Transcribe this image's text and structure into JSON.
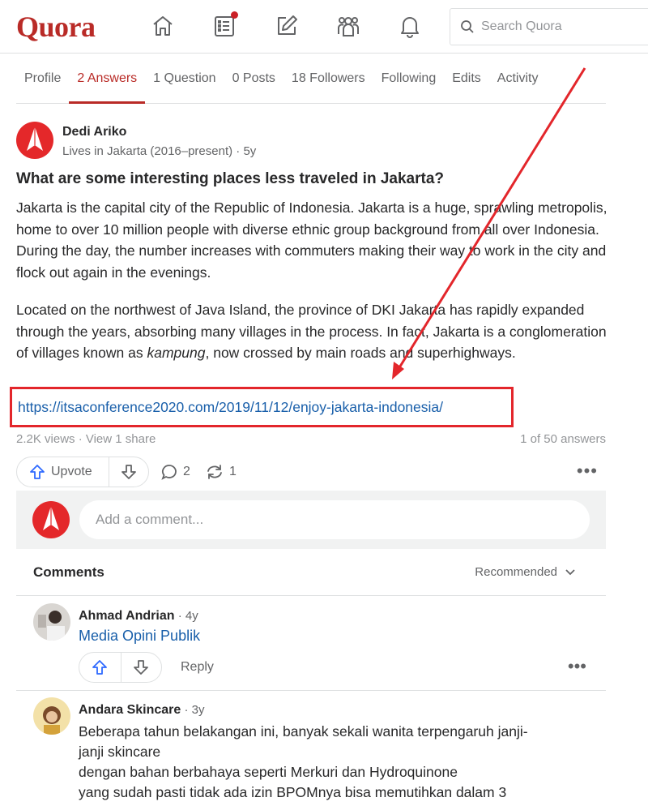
{
  "header": {
    "logo": "Quora",
    "search_placeholder": "Search Quora",
    "icons": [
      "home-icon",
      "answers-icon",
      "edit-icon",
      "spaces-icon",
      "bell-icon"
    ],
    "accent_color": "#b92b27"
  },
  "tabs": [
    {
      "label": "Profile",
      "active": false
    },
    {
      "label": "2 Answers",
      "active": true
    },
    {
      "label": "1 Question",
      "active": false
    },
    {
      "label": "0 Posts",
      "active": false
    },
    {
      "label": "18 Followers",
      "active": false
    },
    {
      "label": "Following",
      "active": false
    },
    {
      "label": "Edits",
      "active": false
    },
    {
      "label": "Activity",
      "active": false
    }
  ],
  "answer": {
    "author_name": "Dedi Ariko",
    "author_meta": "Lives in Jakarta (2016–present) · 5y",
    "question": "What are some interesting places less traveled in Jakarta?",
    "paragraph1": "Jakarta is the capital city of the Republic of Indonesia. Jakarta is a huge, sprawling metropolis, home to over 10 million people with diverse ethnic group background from all over Indonesia. During the day, the number increases with commuters making their way to work in the city and flock out again in the evenings.",
    "paragraph2_before": "Located on the northwest of Java Island, the province of DKI Jakarta has rapidly expanded through the years, absorbing many villages in the process. In fact, Jakarta is a conglomeration of villages known as ",
    "paragraph2_italic": "kampung",
    "paragraph2_after": ", now crossed by main roads and superhighways.",
    "link": "https://itsaconference2020.com/2019/11/12/enjoy-jakarta-indonesia/",
    "stats_left": "2.2K views · View 1 share",
    "stats_right": "1 of 50 answers",
    "upvote_label": "Upvote",
    "comment_count": "2",
    "share_count": "1"
  },
  "comment_box": {
    "placeholder": "Add a comment..."
  },
  "comments_section": {
    "title": "Comments",
    "sort_label": "Recommended"
  },
  "comments": [
    {
      "name": "Ahmad Andrian",
      "time": " · 4y",
      "link": "Media Opini Publik",
      "reply_label": "Reply"
    },
    {
      "name": "Andara Skincare",
      "time": " · 3y",
      "lines": [
        "Beberapa tahun belakangan ini, banyak sekali wanita terpengaruh janji-",
        "janji skincare",
        "dengan bahan berbahaya seperti Merkuri dan Hydroquinone",
        "yang sudah pasti tidak ada izin BPOMnya bisa memutihkan dalam 3"
      ]
    }
  ]
}
